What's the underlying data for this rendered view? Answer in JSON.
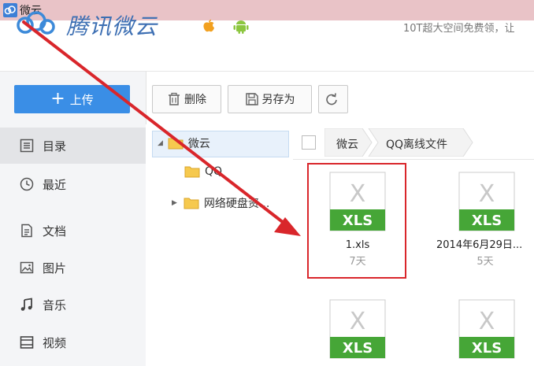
{
  "window": {
    "title": "微云"
  },
  "header": {
    "brand": "腾讯微云",
    "promo": "10T超大空间免费领，让"
  },
  "sidebar": {
    "upload_label": "上传",
    "items": [
      {
        "label": "目录",
        "icon": "list-icon"
      },
      {
        "label": "最近",
        "icon": "clock-icon"
      },
      {
        "label": "文档",
        "icon": "document-icon"
      },
      {
        "label": "图片",
        "icon": "image-icon"
      },
      {
        "label": "音乐",
        "icon": "music-icon"
      },
      {
        "label": "视频",
        "icon": "video-icon"
      }
    ]
  },
  "toolbar": {
    "delete_label": "删除",
    "save_as_label": "另存为"
  },
  "tree": {
    "root": "微云",
    "children": [
      "QQ",
      "网络硬盘资..."
    ]
  },
  "breadcrumb": [
    "微云",
    "QQ离线文件"
  ],
  "files": [
    {
      "badge": "XLS",
      "name": "1.xls",
      "age": "7天"
    },
    {
      "badge": "XLS",
      "name": "2014年6月29日...",
      "age": "5天"
    },
    {
      "badge": "XLS",
      "name": "",
      "age": ""
    },
    {
      "badge": "XLS",
      "name": "",
      "age": ""
    }
  ],
  "colors": {
    "accent_blue": "#3a8ee6",
    "xls_green": "#46a637",
    "highlight_red": "#d9262b"
  }
}
